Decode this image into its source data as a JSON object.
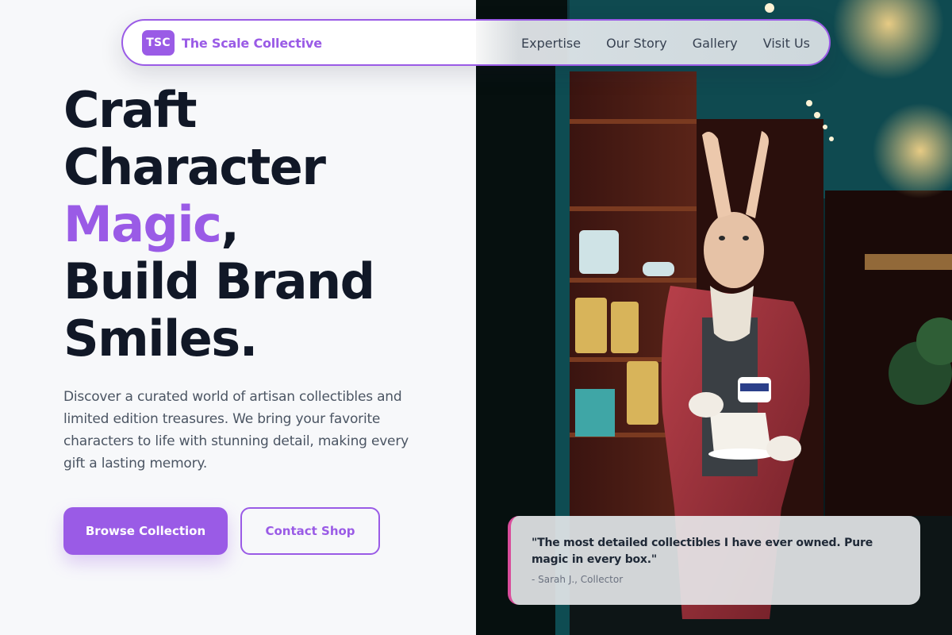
{
  "colors": {
    "accent": "#9a5be6",
    "heading": "#111827",
    "body_text": "#4b5563",
    "quote_border": "#d94d9b"
  },
  "nav": {
    "logo_badge": "TSC",
    "brand": "The Scale Collective",
    "links": [
      "Expertise",
      "Our Story",
      "Gallery",
      "Visit Us"
    ]
  },
  "hero": {
    "line1": "Craft",
    "line2": "Character",
    "line3_accent": "Magic",
    "line3_rest": ",",
    "line4": "Build Brand",
    "line5": "Smiles.",
    "subtext": "Discover a curated world of artisan collectibles and limited edition treasures. We bring your favorite characters to life with stunning detail, making every gift a lasting memory.",
    "primary_button": "Browse Collection",
    "secondary_button": "Contact Shop"
  },
  "testimonial": {
    "quote": "\"The most detailed collectibles I have ever owned. Pure magic in every box.\"",
    "author": "- Sarah J., Collector"
  }
}
